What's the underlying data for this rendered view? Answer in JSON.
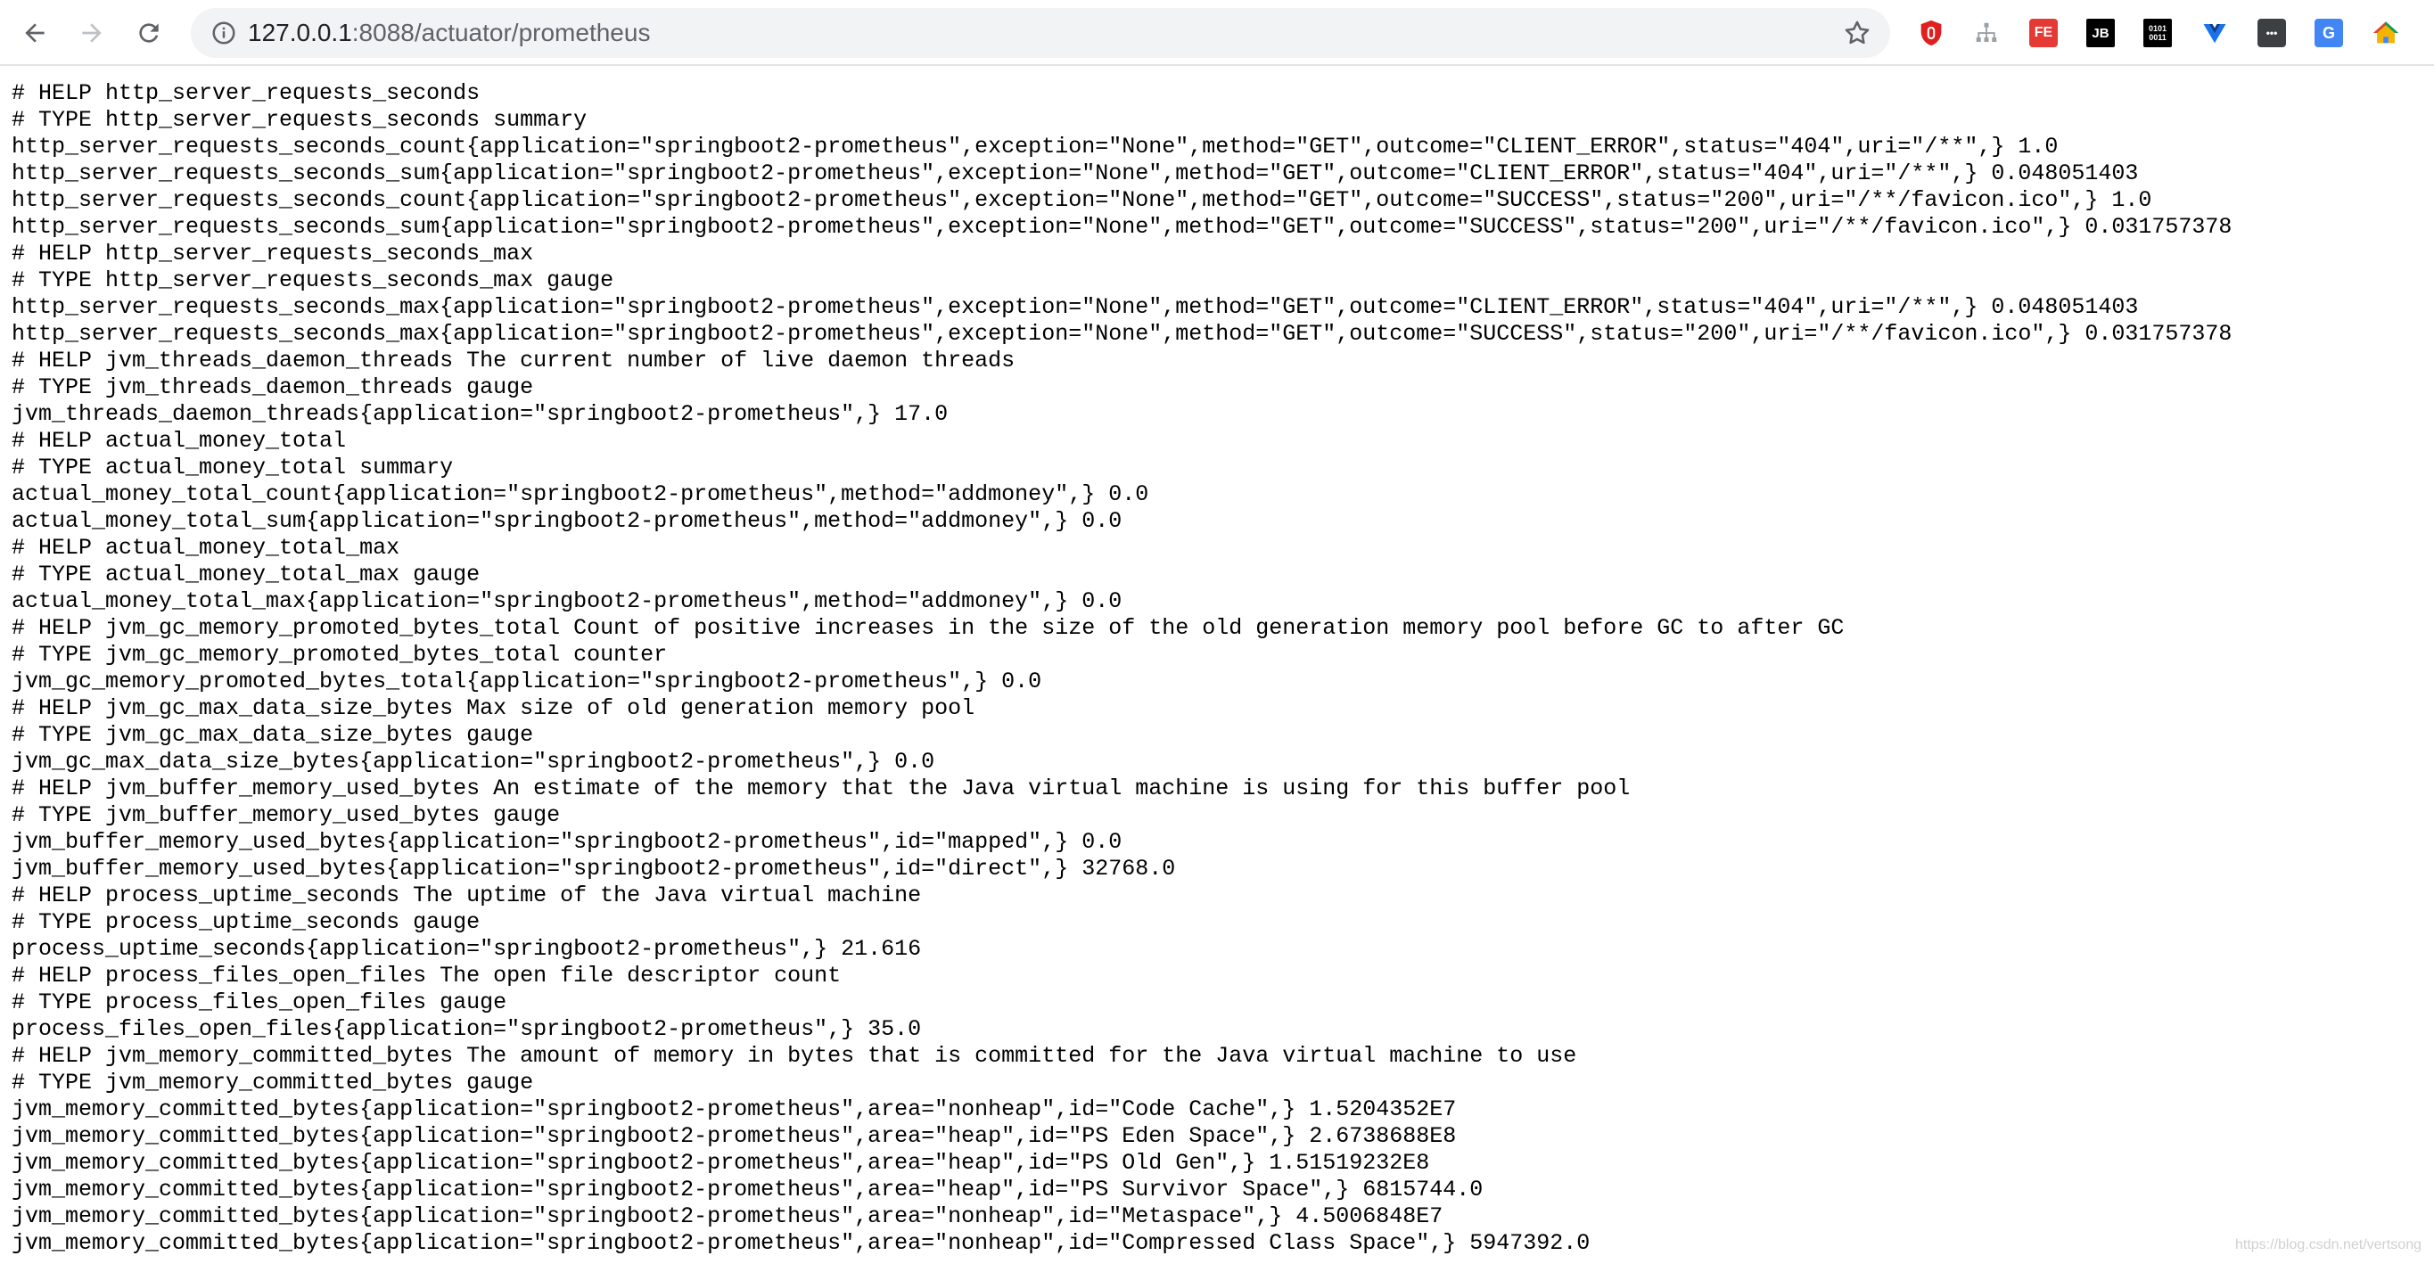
{
  "browser": {
    "url_host": "127.0.0.1",
    "url_rest": ":8088/actuator/prometheus",
    "icons": {
      "back": "arrow-left-icon",
      "forward": "arrow-right-icon",
      "reload": "reload-icon",
      "site_info": "info-circle-icon",
      "bookmark": "star-icon"
    },
    "extensions": [
      {
        "name": "ublock-extension-icon",
        "label": "",
        "color": "#e02020"
      },
      {
        "name": "sitemap-extension-icon",
        "label": "",
        "color": "#9aa0a6"
      },
      {
        "name": "fe-extension-icon",
        "label": "FE",
        "color": "#e53935"
      },
      {
        "name": "jetbrains-extension-icon",
        "label": "JB",
        "color": "#000000"
      },
      {
        "name": "binary-extension-icon",
        "label": "0101\n0011",
        "color": "#000000"
      },
      {
        "name": "vue-devtools-extension-icon",
        "label": "",
        "color": "#1a73e8"
      },
      {
        "name": "more-extension-icon",
        "label": "•••",
        "color": "#3c4043"
      },
      {
        "name": "translate-extension-icon",
        "label": "G",
        "color": "#4285f4"
      },
      {
        "name": "home-extension-icon",
        "label": "",
        "color": "#f4b400"
      }
    ]
  },
  "page": {
    "lines": [
      "# HELP http_server_requests_seconds",
      "# TYPE http_server_requests_seconds summary",
      "http_server_requests_seconds_count{application=\"springboot2-prometheus\",exception=\"None\",method=\"GET\",outcome=\"CLIENT_ERROR\",status=\"404\",uri=\"/**\",} 1.0",
      "http_server_requests_seconds_sum{application=\"springboot2-prometheus\",exception=\"None\",method=\"GET\",outcome=\"CLIENT_ERROR\",status=\"404\",uri=\"/**\",} 0.048051403",
      "http_server_requests_seconds_count{application=\"springboot2-prometheus\",exception=\"None\",method=\"GET\",outcome=\"SUCCESS\",status=\"200\",uri=\"/**/favicon.ico\",} 1.0",
      "http_server_requests_seconds_sum{application=\"springboot2-prometheus\",exception=\"None\",method=\"GET\",outcome=\"SUCCESS\",status=\"200\",uri=\"/**/favicon.ico\",} 0.031757378",
      "# HELP http_server_requests_seconds_max",
      "# TYPE http_server_requests_seconds_max gauge",
      "http_server_requests_seconds_max{application=\"springboot2-prometheus\",exception=\"None\",method=\"GET\",outcome=\"CLIENT_ERROR\",status=\"404\",uri=\"/**\",} 0.048051403",
      "http_server_requests_seconds_max{application=\"springboot2-prometheus\",exception=\"None\",method=\"GET\",outcome=\"SUCCESS\",status=\"200\",uri=\"/**/favicon.ico\",} 0.031757378",
      "# HELP jvm_threads_daemon_threads The current number of live daemon threads",
      "# TYPE jvm_threads_daemon_threads gauge",
      "jvm_threads_daemon_threads{application=\"springboot2-prometheus\",} 17.0",
      "# HELP actual_money_total",
      "# TYPE actual_money_total summary",
      "actual_money_total_count{application=\"springboot2-prometheus\",method=\"addmoney\",} 0.0",
      "actual_money_total_sum{application=\"springboot2-prometheus\",method=\"addmoney\",} 0.0",
      "# HELP actual_money_total_max",
      "# TYPE actual_money_total_max gauge",
      "actual_money_total_max{application=\"springboot2-prometheus\",method=\"addmoney\",} 0.0",
      "# HELP jvm_gc_memory_promoted_bytes_total Count of positive increases in the size of the old generation memory pool before GC to after GC",
      "# TYPE jvm_gc_memory_promoted_bytes_total counter",
      "jvm_gc_memory_promoted_bytes_total{application=\"springboot2-prometheus\",} 0.0",
      "# HELP jvm_gc_max_data_size_bytes Max size of old generation memory pool",
      "# TYPE jvm_gc_max_data_size_bytes gauge",
      "jvm_gc_max_data_size_bytes{application=\"springboot2-prometheus\",} 0.0",
      "# HELP jvm_buffer_memory_used_bytes An estimate of the memory that the Java virtual machine is using for this buffer pool",
      "# TYPE jvm_buffer_memory_used_bytes gauge",
      "jvm_buffer_memory_used_bytes{application=\"springboot2-prometheus\",id=\"mapped\",} 0.0",
      "jvm_buffer_memory_used_bytes{application=\"springboot2-prometheus\",id=\"direct\",} 32768.0",
      "# HELP process_uptime_seconds The uptime of the Java virtual machine",
      "# TYPE process_uptime_seconds gauge",
      "process_uptime_seconds{application=\"springboot2-prometheus\",} 21.616",
      "# HELP process_files_open_files The open file descriptor count",
      "# TYPE process_files_open_files gauge",
      "process_files_open_files{application=\"springboot2-prometheus\",} 35.0",
      "# HELP jvm_memory_committed_bytes The amount of memory in bytes that is committed for the Java virtual machine to use",
      "# TYPE jvm_memory_committed_bytes gauge",
      "jvm_memory_committed_bytes{application=\"springboot2-prometheus\",area=\"nonheap\",id=\"Code Cache\",} 1.5204352E7",
      "jvm_memory_committed_bytes{application=\"springboot2-prometheus\",area=\"heap\",id=\"PS Eden Space\",} 2.6738688E8",
      "jvm_memory_committed_bytes{application=\"springboot2-prometheus\",area=\"heap\",id=\"PS Old Gen\",} 1.51519232E8",
      "jvm_memory_committed_bytes{application=\"springboot2-prometheus\",area=\"heap\",id=\"PS Survivor Space\",} 6815744.0",
      "jvm_memory_committed_bytes{application=\"springboot2-prometheus\",area=\"nonheap\",id=\"Metaspace\",} 4.5006848E7",
      "jvm_memory_committed_bytes{application=\"springboot2-prometheus\",area=\"nonheap\",id=\"Compressed Class Space\",} 5947392.0"
    ],
    "watermark": "https://blog.csdn.net/vertsong"
  }
}
